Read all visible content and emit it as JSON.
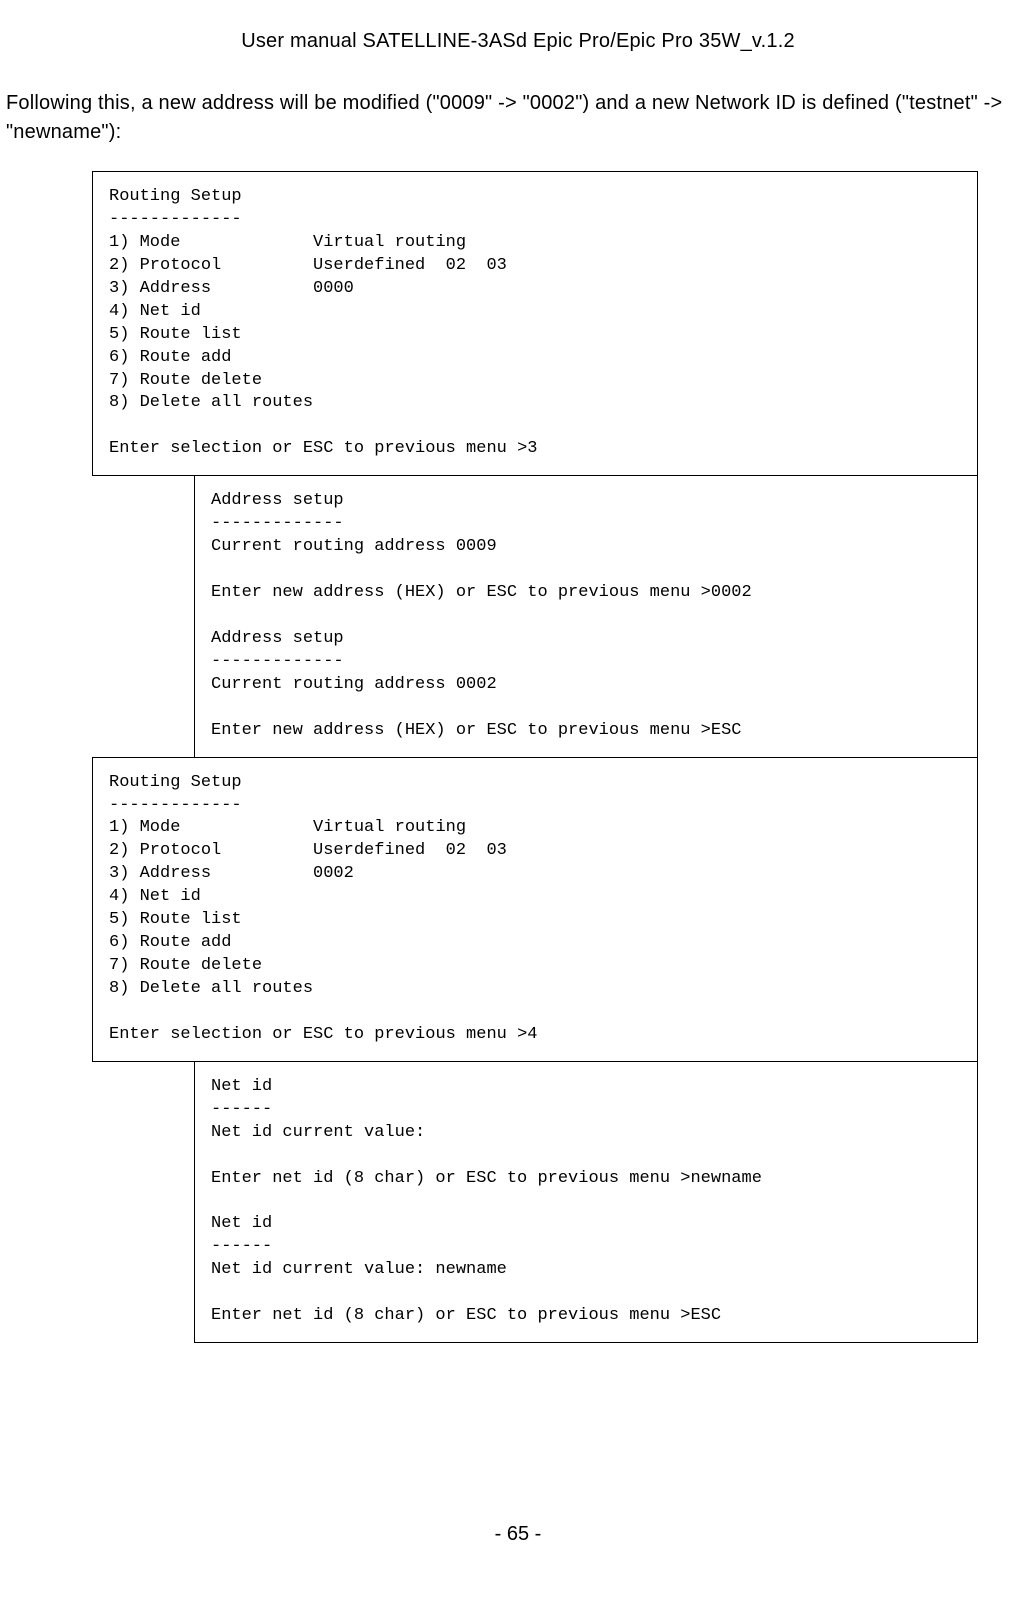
{
  "header": {
    "title": "User manual SATELLINE-3ASd Epic Pro/Epic Pro 35W_v.1.2"
  },
  "intro": "Following this, a new address will be modified (\"0009\" -> \"0002\") and a new Network ID is defined (\"testnet\" -> \"newname\"):",
  "box1": "Routing Setup\n-------------\n1) Mode             Virtual routing\n2) Protocol         Userdefined  02  03\n3) Address          0000\n4) Net id\n5) Route list\n6) Route add\n7) Route delete\n8) Delete all routes\n\nEnter selection or ESC to previous menu >3",
  "box2": "Address setup\n-------------\nCurrent routing address 0009\n\nEnter new address (HEX) or ESC to previous menu >0002\n\nAddress setup\n-------------\nCurrent routing address 0002\n\nEnter new address (HEX) or ESC to previous menu >ESC",
  "box3": "Routing Setup\n-------------\n1) Mode             Virtual routing\n2) Protocol         Userdefined  02  03\n3) Address          0002\n4) Net id\n5) Route list\n6) Route add\n7) Route delete\n8) Delete all routes\n\nEnter selection or ESC to previous menu >4",
  "box4": "Net id\n------\nNet id current value:\n\nEnter net id (8 char) or ESC to previous menu >newname\n\nNet id\n------\nNet id current value: newname\n\nEnter net id (8 char) or ESC to previous menu >ESC",
  "footer": {
    "page": "- 65 -"
  }
}
